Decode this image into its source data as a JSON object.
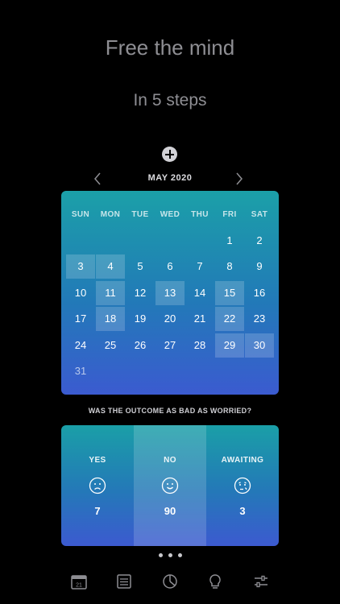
{
  "hero": {
    "title": "Free the mind",
    "subtitle": "In 5 steps"
  },
  "calendar": {
    "month_label": "MAY 2020",
    "weekdays": [
      "SUN",
      "MON",
      "TUE",
      "WED",
      "THU",
      "FRI",
      "SAT"
    ],
    "days": [
      {
        "d": "1",
        "row": 0,
        "col": 5,
        "hl": false
      },
      {
        "d": "2",
        "row": 0,
        "col": 6,
        "hl": false
      },
      {
        "d": "3",
        "row": 1,
        "col": 0,
        "hl": true
      },
      {
        "d": "4",
        "row": 1,
        "col": 1,
        "hl": true
      },
      {
        "d": "5",
        "row": 1,
        "col": 2,
        "hl": false
      },
      {
        "d": "6",
        "row": 1,
        "col": 3,
        "hl": false
      },
      {
        "d": "7",
        "row": 1,
        "col": 4,
        "hl": false
      },
      {
        "d": "8",
        "row": 1,
        "col": 5,
        "hl": false
      },
      {
        "d": "9",
        "row": 1,
        "col": 6,
        "hl": false
      },
      {
        "d": "10",
        "row": 2,
        "col": 0,
        "hl": false
      },
      {
        "d": "11",
        "row": 2,
        "col": 1,
        "hl": true
      },
      {
        "d": "12",
        "row": 2,
        "col": 2,
        "hl": false
      },
      {
        "d": "13",
        "row": 2,
        "col": 3,
        "hl": true
      },
      {
        "d": "14",
        "row": 2,
        "col": 4,
        "hl": false
      },
      {
        "d": "15",
        "row": 2,
        "col": 5,
        "hl": true
      },
      {
        "d": "16",
        "row": 2,
        "col": 6,
        "hl": false
      },
      {
        "d": "17",
        "row": 3,
        "col": 0,
        "hl": false
      },
      {
        "d": "18",
        "row": 3,
        "col": 1,
        "hl": true
      },
      {
        "d": "19",
        "row": 3,
        "col": 2,
        "hl": false
      },
      {
        "d": "20",
        "row": 3,
        "col": 3,
        "hl": false
      },
      {
        "d": "21",
        "row": 3,
        "col": 4,
        "hl": false
      },
      {
        "d": "22",
        "row": 3,
        "col": 5,
        "hl": true
      },
      {
        "d": "23",
        "row": 3,
        "col": 6,
        "hl": false
      },
      {
        "d": "24",
        "row": 4,
        "col": 0,
        "hl": false
      },
      {
        "d": "25",
        "row": 4,
        "col": 1,
        "hl": false
      },
      {
        "d": "26",
        "row": 4,
        "col": 2,
        "hl": false
      },
      {
        "d": "27",
        "row": 4,
        "col": 3,
        "hl": false
      },
      {
        "d": "28",
        "row": 4,
        "col": 4,
        "hl": false
      },
      {
        "d": "29",
        "row": 4,
        "col": 5,
        "hl": true
      },
      {
        "d": "30",
        "row": 4,
        "col": 6,
        "hl": true
      },
      {
        "d": "31",
        "row": 5,
        "col": 0,
        "hl": false
      }
    ]
  },
  "question": "WAS THE OUTCOME AS BAD AS WORRIED?",
  "outcomes": [
    {
      "label": "YES",
      "count": "7",
      "face": "sad-face-icon",
      "selected": false
    },
    {
      "label": "NO",
      "count": "90",
      "face": "happy-face-icon",
      "selected": true
    },
    {
      "label": "AWAITING",
      "count": "3",
      "face": "thinking-face-icon",
      "selected": false
    }
  ],
  "icons": {
    "add": "plus-circle-icon",
    "prev": "chevron-left-icon",
    "next": "chevron-right-icon",
    "tabs": [
      "calendar-icon",
      "list-icon",
      "pie-chart-icon",
      "lightbulb-icon",
      "sliders-icon"
    ]
  },
  "tabbar": {
    "calendar_icon_day": "21"
  },
  "colors": {
    "background": "#000000",
    "headline": "#8e8e93",
    "card_top": "#1ba0a8",
    "card_bottom": "#3b5bd0"
  }
}
